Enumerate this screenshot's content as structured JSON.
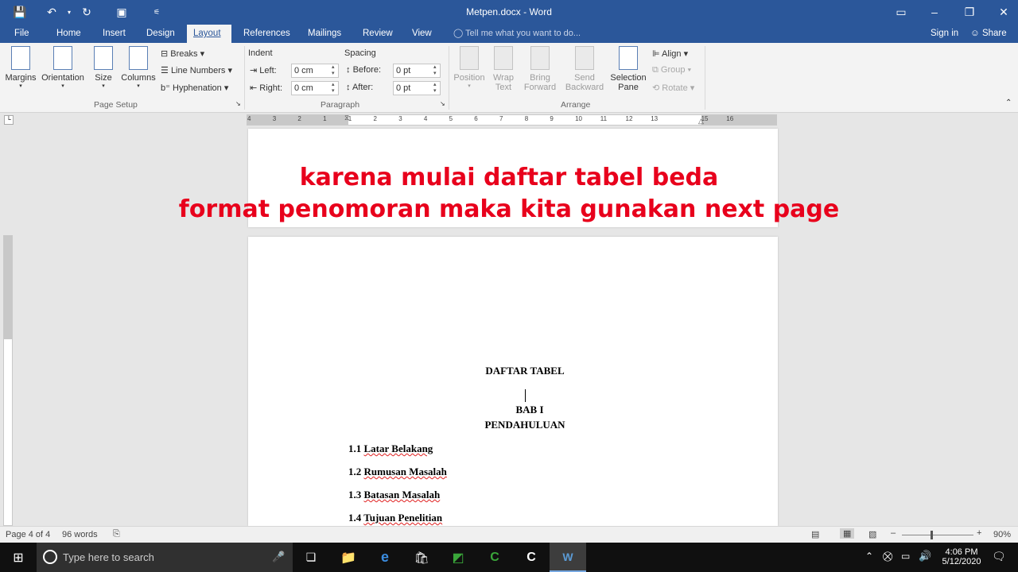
{
  "titlebar": {
    "title": "Metpen.docx - Word"
  },
  "tabs": [
    "File",
    "Home",
    "Insert",
    "Design",
    "Layout",
    "References",
    "Mailings",
    "Review",
    "View"
  ],
  "active_tab": "Layout",
  "tell_me": "Tell me what you want to do...",
  "account": {
    "sign_in": "Sign in",
    "share": "Share"
  },
  "ribbon": {
    "page_setup": {
      "margins": "Margins",
      "orientation": "Orientation",
      "size": "Size",
      "columns": "Columns",
      "breaks": "Breaks",
      "line_numbers": "Line Numbers",
      "hyphenation": "Hyphenation",
      "group": "Page Setup"
    },
    "paragraph": {
      "indent": "Indent",
      "spacing": "Spacing",
      "left": "Left:",
      "right": "Right:",
      "before": "Before:",
      "after": "After:",
      "left_val": "0 cm",
      "right_val": "0 cm",
      "before_val": "0 pt",
      "after_val": "0 pt",
      "group": "Paragraph"
    },
    "arrange": {
      "position": "Position",
      "wrap1": "Wrap",
      "wrap2": "Text",
      "bring1": "Bring",
      "bring2": "Forward",
      "send1": "Send",
      "send2": "Backward",
      "sel1": "Selection",
      "sel2": "Pane",
      "align": "Align",
      "group_btn": "Group",
      "rotate": "Rotate",
      "group": "Arrange"
    }
  },
  "ruler": {
    "marks": [
      "4",
      "3",
      "2",
      "1",
      "1",
      "2",
      "3",
      "4",
      "5",
      "6",
      "7",
      "8",
      "9",
      "10",
      "11",
      "12",
      "13",
      "15",
      "16"
    ]
  },
  "overlay": {
    "line1": "karena mulai daftar tabel beda",
    "line2": "format penomoran maka kita gunakan next page"
  },
  "document": {
    "title1": "DAFTAR TABEL",
    "bab": "BAB I",
    "bab_title": "PENDAHULUAN",
    "items": [
      {
        "num": "1.1",
        "text": "Latar Belakang"
      },
      {
        "num": "1.2",
        "text": "Rumusan Masalah"
      },
      {
        "num": "1.3",
        "text": "Batasan Masalah"
      },
      {
        "num": "1.4",
        "text": "Tujuan Penelitian"
      }
    ]
  },
  "status": {
    "page": "Page 4 of 4",
    "words": "96 words",
    "zoom": "90%"
  },
  "taskbar": {
    "search": "Type here to search",
    "time": "4:06 PM",
    "date": "5/12/2020"
  },
  "colors": {
    "word_blue": "#2b579a",
    "overlay_red": "#e8001c"
  }
}
